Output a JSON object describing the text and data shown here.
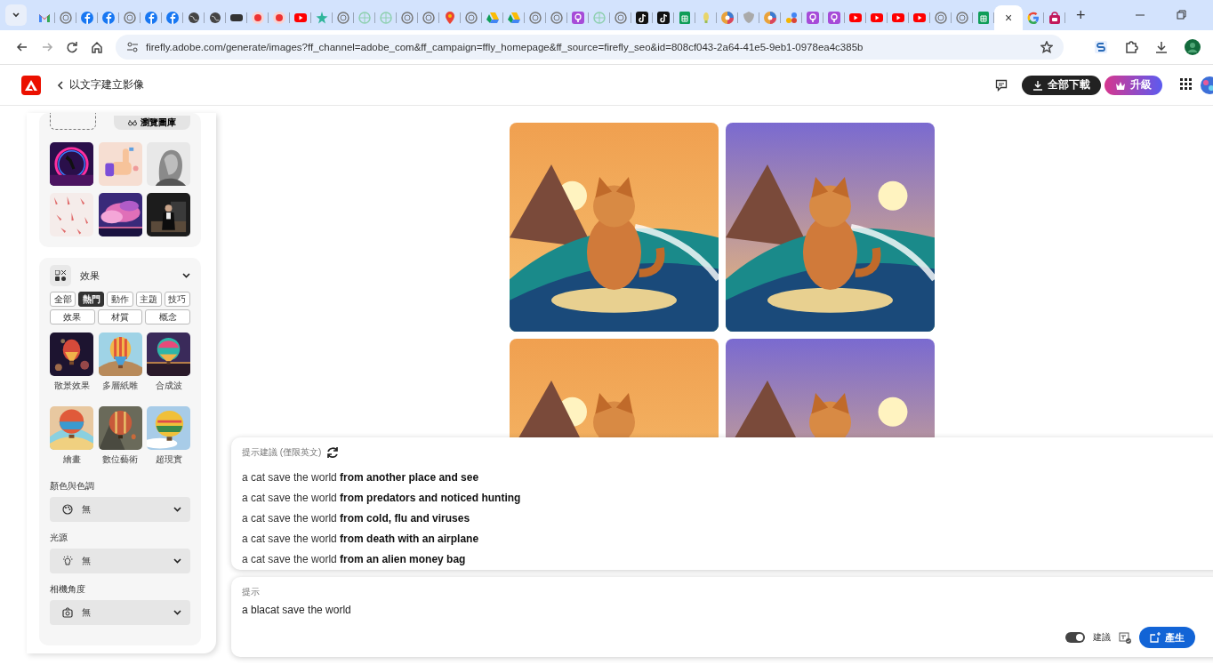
{
  "browser": {
    "tabs": [
      {
        "kind": "gmail",
        "selected": false
      },
      {
        "kind": "globe",
        "selected": false
      },
      {
        "kind": "facebook",
        "selected": false
      },
      {
        "kind": "facebook",
        "selected": false
      },
      {
        "kind": "globe",
        "selected": false
      },
      {
        "kind": "facebook",
        "selected": false
      },
      {
        "kind": "facebook",
        "selected": false
      },
      {
        "kind": "darkglobe",
        "selected": false
      },
      {
        "kind": "darkglobe",
        "selected": false
      },
      {
        "kind": "badge",
        "selected": false
      },
      {
        "kind": "record",
        "selected": false
      },
      {
        "kind": "record",
        "selected": false
      },
      {
        "kind": "youtube",
        "selected": false
      },
      {
        "kind": "star",
        "selected": false
      },
      {
        "kind": "globe",
        "selected": false
      },
      {
        "kind": "lightglobe",
        "selected": false
      },
      {
        "kind": "lightglobe",
        "selected": false
      },
      {
        "kind": "globe",
        "selected": false
      },
      {
        "kind": "globe",
        "selected": false
      },
      {
        "kind": "maps",
        "selected": false
      },
      {
        "kind": "globe",
        "selected": false
      },
      {
        "kind": "drive",
        "selected": false
      },
      {
        "kind": "drive",
        "selected": false
      },
      {
        "kind": "globe",
        "selected": false
      },
      {
        "kind": "globe",
        "selected": false
      },
      {
        "kind": "podcast",
        "selected": false
      },
      {
        "kind": "lightglobe",
        "selected": false
      },
      {
        "kind": "globe",
        "selected": false
      },
      {
        "kind": "tiktok",
        "selected": false
      },
      {
        "kind": "tiktok",
        "selected": false
      },
      {
        "kind": "sheets",
        "selected": false
      },
      {
        "kind": "yellow",
        "selected": false
      },
      {
        "kind": "colorful",
        "selected": false
      },
      {
        "kind": "gray",
        "selected": false
      },
      {
        "kind": "colorful",
        "selected": false
      },
      {
        "kind": "dots",
        "selected": false
      },
      {
        "kind": "podcast",
        "selected": false
      },
      {
        "kind": "podcast",
        "selected": false
      },
      {
        "kind": "youtube",
        "selected": false
      },
      {
        "kind": "youtube",
        "selected": false
      },
      {
        "kind": "youtube",
        "selected": false
      },
      {
        "kind": "youtube",
        "selected": false
      },
      {
        "kind": "globe",
        "selected": false
      },
      {
        "kind": "globe",
        "selected": false
      },
      {
        "kind": "sheets",
        "selected": false
      },
      {
        "kind": "page",
        "selected": true,
        "close": "×"
      },
      {
        "kind": "google",
        "selected": false
      },
      {
        "kind": "store",
        "selected": false
      }
    ],
    "new_tab": "+",
    "address": "firefly.adobe.com/generate/images?ff_channel=adobe_com&ff_campaign=ffly_homepage&ff_source=firefly_seo&id=808cf043-2a64-41e5-9eb1-0978ea4c385b"
  },
  "header": {
    "title": "以文字建立影像",
    "download_all": "全部下載",
    "upgrade": "升級"
  },
  "sidebar": {
    "browse_gallery": "瀏覽圖庫",
    "effects": {
      "title": "效果",
      "filters": [
        {
          "label": "全部",
          "selected": false
        },
        {
          "label": "熱門",
          "selected": true
        },
        {
          "label": "動作",
          "selected": false
        },
        {
          "label": "主題",
          "selected": false
        },
        {
          "label": "技巧",
          "selected": false
        },
        {
          "label": "效果",
          "selected": false
        },
        {
          "label": "材質",
          "selected": false
        },
        {
          "label": "概念",
          "selected": false
        }
      ],
      "items": [
        {
          "label": "散景效果"
        },
        {
          "label": "多層紙雕"
        },
        {
          "label": "合成波"
        },
        {
          "label": "繪畫"
        },
        {
          "label": "數位藝術"
        },
        {
          "label": "超現實"
        }
      ]
    },
    "settings": [
      {
        "kind": "color",
        "label": "顏色與色調",
        "value": "無"
      },
      {
        "kind": "light",
        "label": "光源",
        "value": "無"
      },
      {
        "kind": "camera",
        "label": "相機角度",
        "value": "無"
      }
    ]
  },
  "suggestions": {
    "title": "提示建議 (僅限英文)",
    "items": [
      "a cat save the world **from another place and see**",
      "a cat save the world **from predators and noticed hunting**",
      "a cat save the world **from cold, flu and viruses**",
      "a cat save the world **from death with an airplane**",
      "a cat save the world **from an alien money bag**"
    ]
  },
  "prompt": {
    "label": "提示",
    "value": "a blacat save the world",
    "suggestions_toggle": {
      "label": "建議",
      "on": true
    },
    "generate": "產生"
  }
}
